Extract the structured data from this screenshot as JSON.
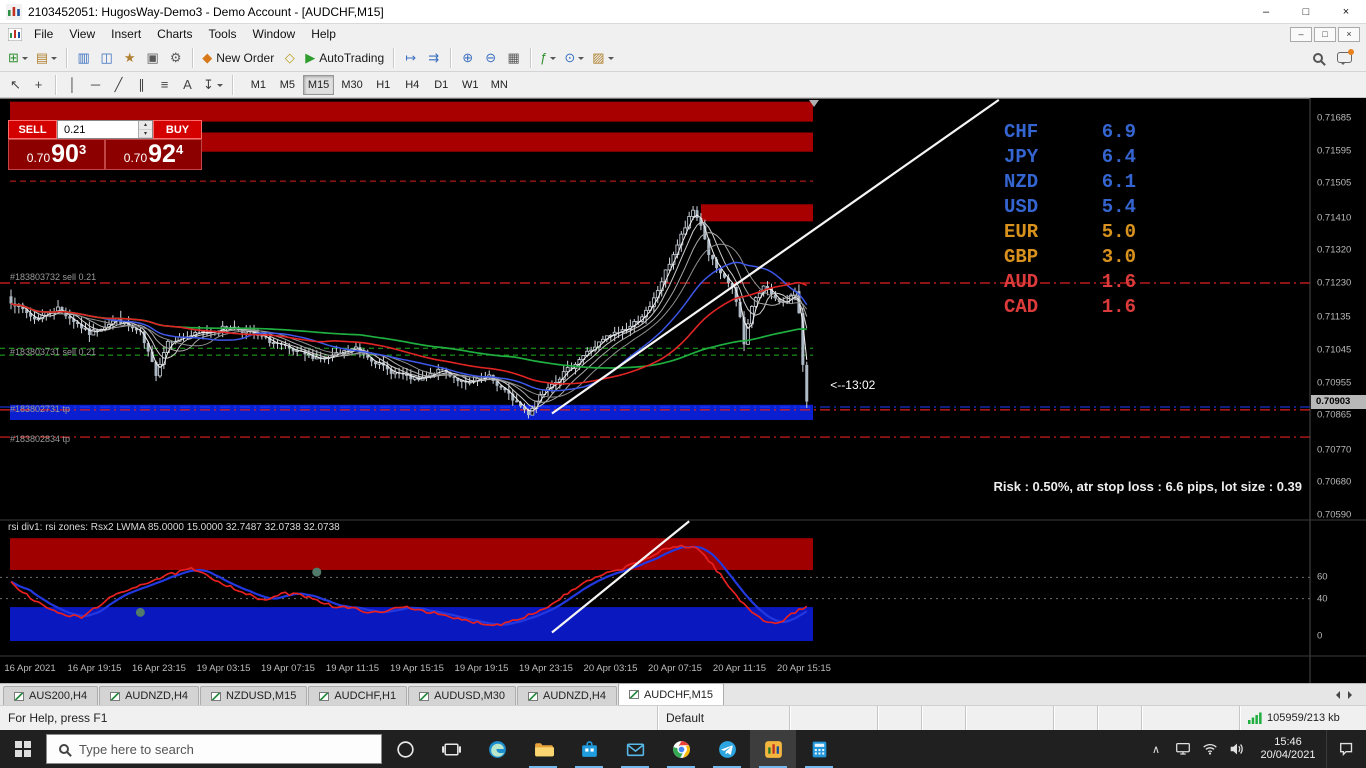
{
  "titlebar": {
    "title": "2103452051: HugosWay-Demo3 - Demo Account - [AUDCHF,M15]",
    "controls": {
      "minimize": "–",
      "restore": "□",
      "close": "×"
    }
  },
  "menubar": {
    "items": [
      "File",
      "View",
      "Insert",
      "Charts",
      "Tools",
      "Window",
      "Help"
    ],
    "controls": {
      "minimize": "–",
      "restore": "□",
      "close": "×"
    }
  },
  "toolbar_main": [
    {
      "name": "new-chart-button",
      "glyph": "⊞",
      "color": "#2f8f2f",
      "caret": true
    },
    {
      "name": "profiles-button",
      "glyph": "▤",
      "color": "#b08030",
      "caret": true
    },
    {
      "sep": true
    },
    {
      "name": "market-watch-button",
      "glyph": "▥",
      "color": "#3a6fbf"
    },
    {
      "name": "data-window-button",
      "glyph": "◫",
      "color": "#3a6fbf"
    },
    {
      "name": "navigator-button",
      "glyph": "★",
      "color": "#b08030"
    },
    {
      "name": "terminal-button",
      "glyph": "▣",
      "color": "#5a5a5a"
    },
    {
      "name": "strategy-tester-button",
      "glyph": "⚙",
      "color": "#5a5a5a"
    },
    {
      "sep": true
    },
    {
      "name": "new-order-button",
      "glyph": "◆",
      "color": "#d87818",
      "label": "New Order"
    },
    {
      "name": "metaeditor-button",
      "glyph": "◇",
      "color": "#b8a020"
    },
    {
      "name": "autotrading-button",
      "glyph": "▶",
      "color": "#2f9e2f",
      "label": "AutoTrading"
    },
    {
      "sep": true
    },
    {
      "name": "chart-shift-button",
      "glyph": "↦",
      "color": "#3a6fbf"
    },
    {
      "name": "auto-scroll-button",
      "glyph": "⇉",
      "color": "#3a6fbf"
    },
    {
      "sep": true
    },
    {
      "name": "zoom-in-button",
      "glyph": "⊕",
      "color": "#3a6fbf"
    },
    {
      "name": "zoom-out-button",
      "glyph": "⊖",
      "color": "#3a6fbf"
    },
    {
      "name": "tile-windows-button",
      "glyph": "▦",
      "color": "#5a5a5a"
    },
    {
      "sep": true
    },
    {
      "name": "indicators-button",
      "glyph": "ƒ",
      "color": "#2f8f2f",
      "caret": true
    },
    {
      "name": "periods-button",
      "glyph": "⊙",
      "color": "#3a6fbf",
      "caret": true
    },
    {
      "name": "templates-button",
      "glyph": "▨",
      "color": "#b08030",
      "caret": true
    }
  ],
  "toolbar_draw": [
    {
      "name": "cursor-tool",
      "glyph": "↖"
    },
    {
      "name": "crosshair-tool",
      "glyph": "+"
    },
    {
      "sep": true
    },
    {
      "name": "vertical-line-tool",
      "glyph": "│"
    },
    {
      "name": "horizontal-line-tool",
      "glyph": "─"
    },
    {
      "name": "trendline-tool",
      "glyph": "╱"
    },
    {
      "name": "channel-tool",
      "glyph": "∥"
    },
    {
      "name": "fibonacci-tool",
      "glyph": "≡"
    },
    {
      "name": "text-tool",
      "glyph": "A"
    },
    {
      "name": "arrows-tool",
      "glyph": "↧",
      "caret": true
    },
    {
      "sep": true
    }
  ],
  "toolbar": {
    "timeframes": [
      "M1",
      "M5",
      "M15",
      "M30",
      "H1",
      "H4",
      "D1",
      "W1",
      "MN"
    ],
    "active_timeframe": "M15"
  },
  "trade_panel": {
    "sell_label": "SELL",
    "buy_label": "BUY",
    "volume": "0.21",
    "sell_price": {
      "prefix": "0.70",
      "big": "90",
      "sup": "3"
    },
    "buy_price": {
      "prefix": "0.70",
      "big": "92",
      "sup": "4"
    }
  },
  "strength_meter": {
    "rows": [
      {
        "code": "CHF",
        "value": "6.9",
        "color": "#3565d0"
      },
      {
        "code": "JPY",
        "value": "6.4",
        "color": "#3565d0"
      },
      {
        "code": "NZD",
        "value": "6.1",
        "color": "#3565d0"
      },
      {
        "code": "USD",
        "value": "5.4",
        "color": "#3565d0"
      },
      {
        "code": "EUR",
        "value": "5.0",
        "color": "#d9921e"
      },
      {
        "code": "GBP",
        "value": "3.0",
        "color": "#d9921e"
      },
      {
        "code": "AUD",
        "value": "1.6",
        "color": "#dd3b3b"
      },
      {
        "code": "CAD",
        "value": "1.6",
        "color": "#dd3b3b"
      }
    ]
  },
  "chart_data": {
    "type": "candlestick",
    "symbol": "AUDCHF",
    "timeframe": "M15",
    "bars": 204,
    "price_scale": {
      "labels": [
        "0.71685",
        "0.71595",
        "0.71505",
        "0.71410",
        "0.71320",
        "0.71230",
        "0.71135",
        "0.71045",
        "0.70955",
        "0.70865",
        "0.70770",
        "0.70680",
        "0.70590"
      ],
      "current": "0.70903"
    },
    "time_labels": [
      "16 Apr 2021",
      "16 Apr 19:15",
      "16 Apr 23:15",
      "19 Apr 03:15",
      "19 Apr 07:15",
      "19 Apr 11:15",
      "19 Apr 15:15",
      "19 Apr 19:15",
      "19 Apr 23:15",
      "20 Apr 03:15",
      "20 Apr 07:15",
      "20 Apr 11:15",
      "20 Apr 15:15"
    ],
    "price_anchors": [
      [
        0,
        0.7118
      ],
      [
        6,
        0.7113
      ],
      [
        12,
        0.7116
      ],
      [
        20,
        0.7109
      ],
      [
        27,
        0.7113
      ],
      [
        33,
        0.7109
      ],
      [
        37,
        0.7098
      ],
      [
        40,
        0.7107
      ],
      [
        48,
        0.7109
      ],
      [
        56,
        0.7111
      ],
      [
        64,
        0.7108
      ],
      [
        72,
        0.7104
      ],
      [
        80,
        0.7102
      ],
      [
        88,
        0.7105
      ],
      [
        96,
        0.7099
      ],
      [
        104,
        0.7096
      ],
      [
        110,
        0.7099
      ],
      [
        116,
        0.7095
      ],
      [
        122,
        0.7097
      ],
      [
        128,
        0.7091
      ],
      [
        132,
        0.7087
      ],
      [
        136,
        0.7094
      ],
      [
        140,
        0.7097
      ],
      [
        146,
        0.7103
      ],
      [
        152,
        0.7108
      ],
      [
        158,
        0.7111
      ],
      [
        163,
        0.7116
      ],
      [
        167,
        0.7126
      ],
      [
        171,
        0.7136
      ],
      [
        174,
        0.7143
      ],
      [
        176,
        0.7139
      ],
      [
        178,
        0.7131
      ],
      [
        181,
        0.7125
      ],
      [
        184,
        0.7122
      ],
      [
        186,
        0.7113
      ],
      [
        187,
        0.7106
      ],
      [
        189,
        0.7117
      ],
      [
        192,
        0.7122
      ],
      [
        195,
        0.7119
      ],
      [
        198,
        0.7117
      ],
      [
        200,
        0.7121
      ],
      [
        201,
        0.7115
      ],
      [
        202,
        0.7101
      ],
      [
        203,
        0.70903
      ]
    ],
    "supply_zones": [
      {
        "top": 0.7173,
        "bottom": 0.71675
      },
      {
        "top": 0.71645,
        "bottom": 0.71592
      },
      {
        "top": 0.71447,
        "bottom": 0.714,
        "from_bar": 176
      }
    ],
    "tp_zone": {
      "top": 0.70894,
      "bottom": 0.70852
    },
    "levels": {
      "dashed_red": [
        0.71511
      ],
      "dashdot_red": [
        0.7123,
        0.7088,
        0.70805
      ],
      "dashed_green": [
        0.7105,
        0.71031
      ],
      "dashdot_blue": [
        0.70888
      ]
    },
    "orders": [
      {
        "label": "#183803732 sell 0.21",
        "price": 0.71246
      },
      {
        "label": "#183803731 sell 0.21",
        "price": 0.7104
      },
      {
        "label": "#183802731 tp",
        "price": 0.70882
      },
      {
        "label": "#183802834 tp",
        "price": 0.708
      }
    ],
    "trendline": {
      "from_bar": 138,
      "from_price": 0.7087,
      "to_bar": 252,
      "to_price": 0.71735
    },
    "annotation": {
      "text": "<--13:02",
      "bar": 209,
      "price": 0.70948
    },
    "risk_note": "Risk : 0.50%, atr stop loss : 6.6 pips, lot size : 0.39",
    "ma": {
      "ribbon": [
        {
          "period": 3,
          "color": "#f2f2f2"
        },
        {
          "period": 6,
          "color": "#cfcfcf"
        },
        {
          "period": 10,
          "color": "#ababab"
        },
        {
          "period": 15,
          "color": "#8d8d8d"
        }
      ],
      "blue": {
        "period": 24,
        "color": "#3d57e8"
      },
      "red": {
        "period": 44,
        "color": "#e02424"
      },
      "green": {
        "period": 90,
        "color": "#1fae3f"
      }
    },
    "rsi": {
      "label": "rsi div1: rsi zones: Rsx2 LWMA 85.0000 15.0000 32.7487 32.0738 32.0738",
      "scale_labels": [
        "60",
        "40",
        "0"
      ],
      "upper_zone": [
        67,
        97
      ],
      "lower_zone": [
        0,
        32
      ],
      "levels": [
        60,
        40
      ],
      "anchors": [
        [
          0,
          55
        ],
        [
          6,
          38
        ],
        [
          12,
          26
        ],
        [
          18,
          22
        ],
        [
          24,
          38
        ],
        [
          32,
          52
        ],
        [
          40,
          62
        ],
        [
          46,
          68
        ],
        [
          52,
          58
        ],
        [
          58,
          48
        ],
        [
          64,
          38
        ],
        [
          70,
          45
        ],
        [
          76,
          42
        ],
        [
          82,
          33
        ],
        [
          88,
          30
        ],
        [
          94,
          26
        ],
        [
          100,
          33
        ],
        [
          106,
          28
        ],
        [
          112,
          22
        ],
        [
          118,
          18
        ],
        [
          124,
          15
        ],
        [
          130,
          22
        ],
        [
          136,
          30
        ],
        [
          142,
          45
        ],
        [
          148,
          58
        ],
        [
          154,
          66
        ],
        [
          160,
          74
        ],
        [
          166,
          85
        ],
        [
          171,
          90
        ],
        [
          175,
          88
        ],
        [
          179,
          72
        ],
        [
          183,
          52
        ],
        [
          186,
          38
        ],
        [
          189,
          28
        ],
        [
          192,
          20
        ],
        [
          195,
          16
        ],
        [
          198,
          22
        ],
        [
          201,
          30
        ],
        [
          203,
          32
        ]
      ],
      "dots": [
        [
          33,
          27
        ],
        [
          78,
          65
        ]
      ],
      "white_line": {
        "from_bar": 138,
        "from_value": 8,
        "to_bar": 173,
        "to_value": 113
      },
      "colors": {
        "fast": "#2238e0",
        "slow": "#e82020",
        "zone_upper": "#a00000",
        "zone_lower": "#0a18c0"
      }
    }
  },
  "tabbar": {
    "tabs": [
      "AUS200,H4",
      "AUDNZD,H4",
      "NZDUSD,M15",
      "AUDCHF,H1",
      "AUDUSD,M30",
      "AUDNZD,H4",
      "AUDCHF,M15"
    ],
    "active_index": 6
  },
  "statusbar": {
    "help": "For Help, press F1",
    "profile": "Default",
    "traffic": "105959/213 kb"
  },
  "taskbar": {
    "search_placeholder": "Type here to search",
    "apps": [
      {
        "name": "cortana-icon"
      },
      {
        "name": "task-view-icon"
      },
      {
        "name": "edge-icon"
      },
      {
        "name": "file-explorer-icon",
        "open": true
      },
      {
        "name": "store-icon",
        "open": true
      },
      {
        "name": "mail-icon",
        "open": true
      },
      {
        "name": "chrome-icon",
        "open": true
      },
      {
        "name": "telegram-icon",
        "open": true
      },
      {
        "name": "mt4-icon",
        "open": true,
        "active": true
      },
      {
        "name": "calculator-icon",
        "open": true
      }
    ],
    "tray": {
      "icons": [
        {
          "name": "monitor-icon"
        },
        {
          "name": "network-icon"
        },
        {
          "name": "volume-icon"
        }
      ],
      "time": "15:46",
      "date": "20/04/2021"
    }
  }
}
